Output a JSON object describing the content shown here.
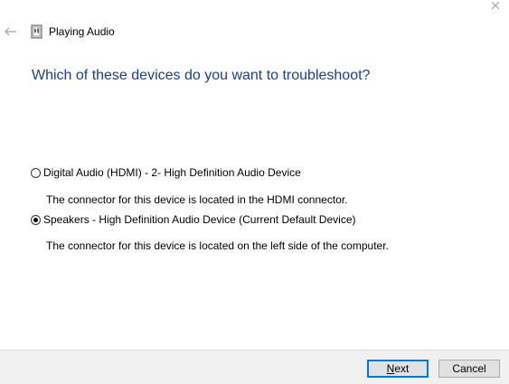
{
  "window": {
    "title": "Playing Audio"
  },
  "heading": "Which of these devices do you want to troubleshoot?",
  "options": [
    {
      "label": "Digital Audio (HDMI) - 2- High Definition Audio Device",
      "description": "The connector for this device is located in the HDMI connector.",
      "selected": false
    },
    {
      "label": "Speakers - High Definition Audio Device (Current Default Device)",
      "description": "The connector for this device is located on the left side of the computer.",
      "selected": true
    }
  ],
  "buttons": {
    "next_first_letter": "N",
    "next_rest": "ext",
    "cancel": "Cancel"
  },
  "icons": {
    "close": "close-icon",
    "back": "back-arrow-icon",
    "title": "troubleshooter-icon"
  },
  "colors": {
    "heading": "#1c3f94",
    "default_button_border": "#0078d7",
    "footer_bg": "#f0f0f0"
  }
}
